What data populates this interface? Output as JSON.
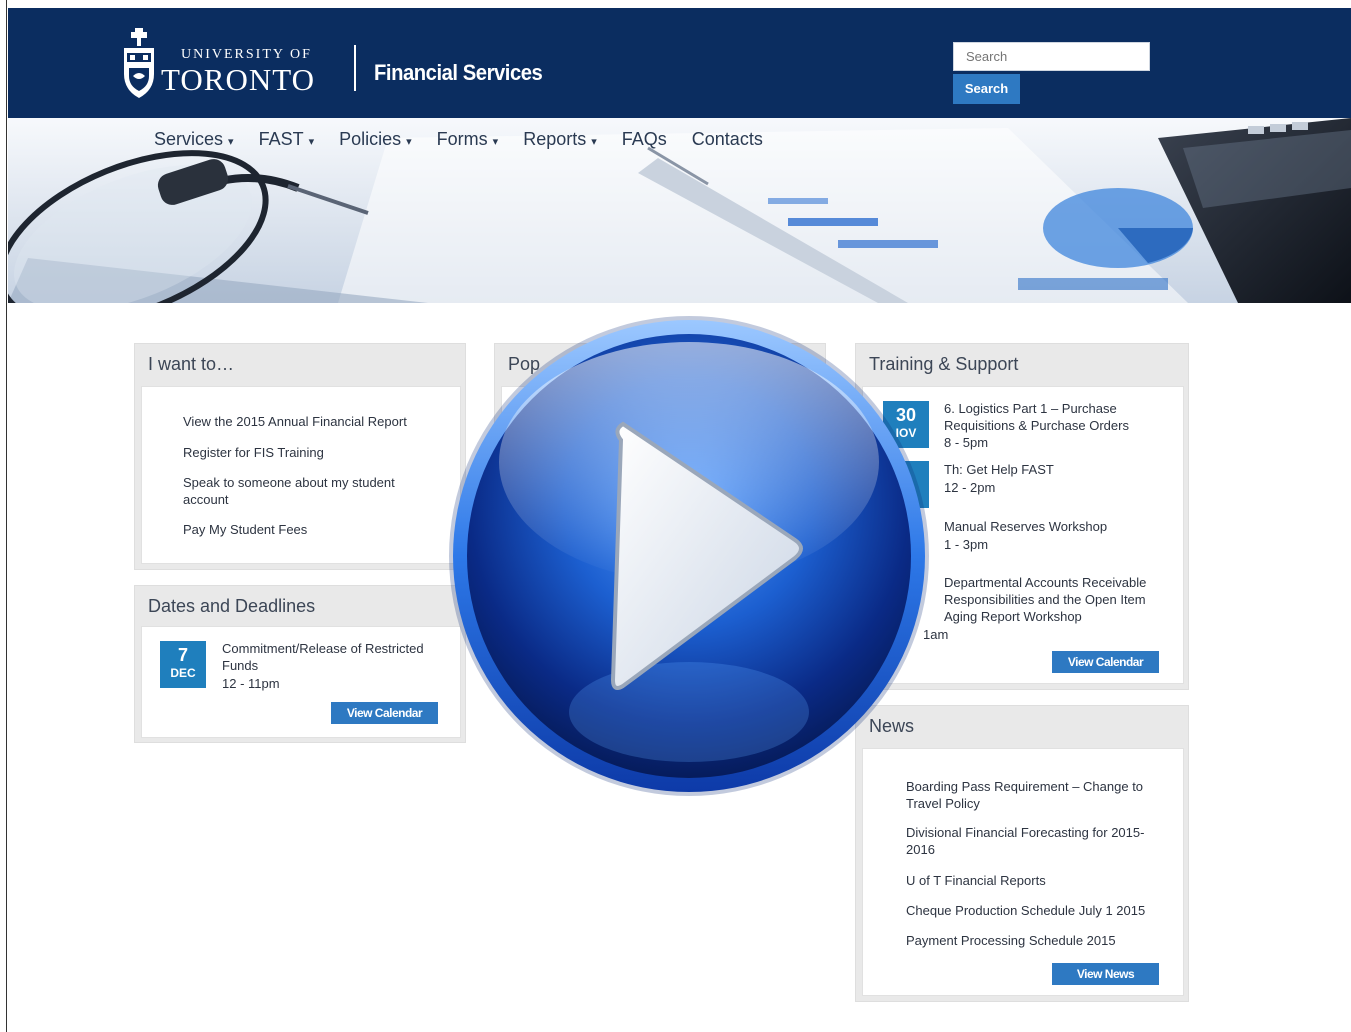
{
  "header": {
    "university_top": "UNIVERSITY OF",
    "university_main": "TORONTO",
    "department": "Financial Services",
    "search_placeholder": "Search",
    "search_button": "Search"
  },
  "nav": [
    {
      "label": "Services",
      "dropdown": true
    },
    {
      "label": "FAST",
      "dropdown": true
    },
    {
      "label": "Policies",
      "dropdown": true
    },
    {
      "label": "Forms",
      "dropdown": true
    },
    {
      "label": "Reports",
      "dropdown": true
    },
    {
      "label": "FAQs",
      "dropdown": false
    },
    {
      "label": "Contacts",
      "dropdown": false
    }
  ],
  "i_want_to": {
    "title": "I want to…",
    "links": [
      "View the 2015 Annual Financial Report",
      "Register for FIS Training",
      "Speak to someone about my student account",
      "Pay My Student Fees"
    ]
  },
  "dates_deadlines": {
    "title": "Dates and Deadlines",
    "event": {
      "day": "7",
      "month": "DEC",
      "title": "Commitment/Release of Restricted Funds",
      "time": "12 - 11pm"
    },
    "button": "View Calendar"
  },
  "popular": {
    "title_partial": "Pop"
  },
  "training": {
    "title": "Training & Support",
    "badge_day": "30",
    "badge_month": "IOV",
    "events": [
      {
        "title": "6. Logistics Part 1 – Purchase Requisitions & Purchase Orders",
        "time": "8 - 5pm"
      },
      {
        "title": "Th: Get Help FAST",
        "time": "12 - 2pm"
      },
      {
        "title": "Manual Reserves Workshop",
        "time": "1 - 3pm"
      },
      {
        "title": "Departmental Accounts Receivable Responsibilities and the Open Item Aging Report Workshop",
        "time": "1am"
      }
    ],
    "button": "View Calendar"
  },
  "news": {
    "title": "News",
    "items": [
      "Boarding Pass Requirement – Change to Travel Policy",
      "Divisional Financial Forecasting for 2015-2016",
      "U of T Financial Reports",
      "Cheque Production Schedule July 1 2015",
      "Payment Processing Schedule 2015"
    ],
    "button": "View News"
  },
  "colors": {
    "header_bg": "#0b2d60",
    "accent": "#2e79c2",
    "badge": "#1f7fbd",
    "play": "#1a56c0"
  },
  "icons": {
    "crest": "university-crest-icon",
    "play": "play-button-icon"
  }
}
